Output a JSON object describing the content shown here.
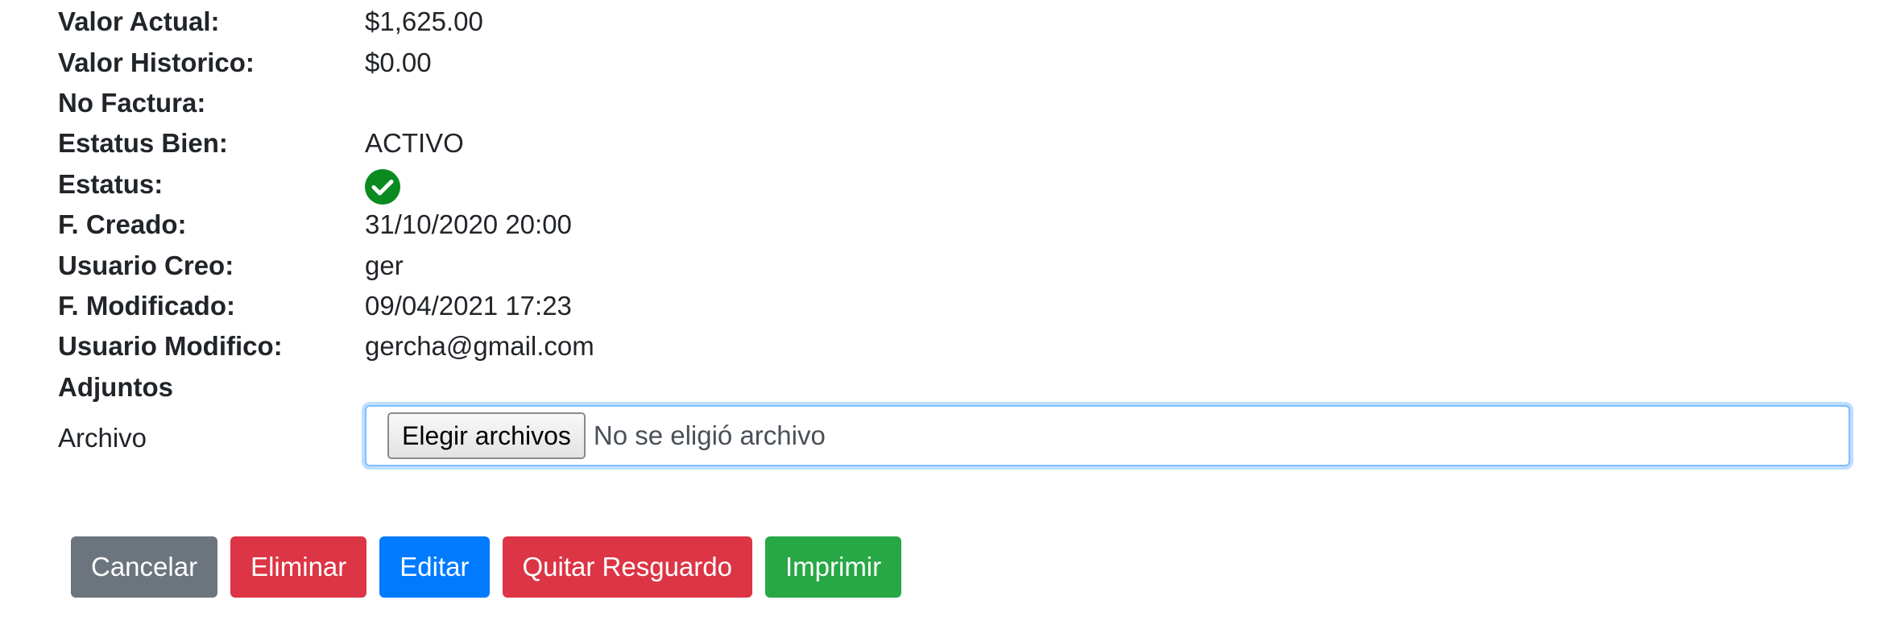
{
  "details": {
    "valor_actual": {
      "label": "Valor Actual:",
      "value": "$1,625.00"
    },
    "valor_historico": {
      "label": "Valor Historico:",
      "value": "$0.00"
    },
    "no_factura": {
      "label": "No Factura:",
      "value": ""
    },
    "estatus_bien": {
      "label": "Estatus Bien:",
      "value": "ACTIVO"
    },
    "estatus": {
      "label": "Estatus:",
      "icon": "check-circle-icon",
      "color": "#0a8a1f"
    },
    "f_creado": {
      "label": "F. Creado:",
      "value": "31/10/2020 20:00"
    },
    "usuario_creo": {
      "label": "Usuario Creo:",
      "value": "ger"
    },
    "f_modificado": {
      "label": "F. Modificado:",
      "value": "09/04/2021 17:23"
    },
    "usuario_modifico": {
      "label": "Usuario Modifico:",
      "value": "gercha@gmail.com"
    },
    "adjuntos": {
      "label": "Adjuntos"
    }
  },
  "file": {
    "label": "Archivo",
    "button_label": "Elegir archivos",
    "status": "No se eligió archivo"
  },
  "actions": {
    "cancelar": "Cancelar",
    "eliminar": "Eliminar",
    "editar": "Editar",
    "quitar_resguardo": "Quitar Resguardo",
    "imprimir": "Imprimir"
  },
  "colors": {
    "secondary": "#6c757d",
    "danger": "#dc3545",
    "primary": "#007bff",
    "success": "#28a745",
    "status_ok": "#0a8a1f"
  }
}
